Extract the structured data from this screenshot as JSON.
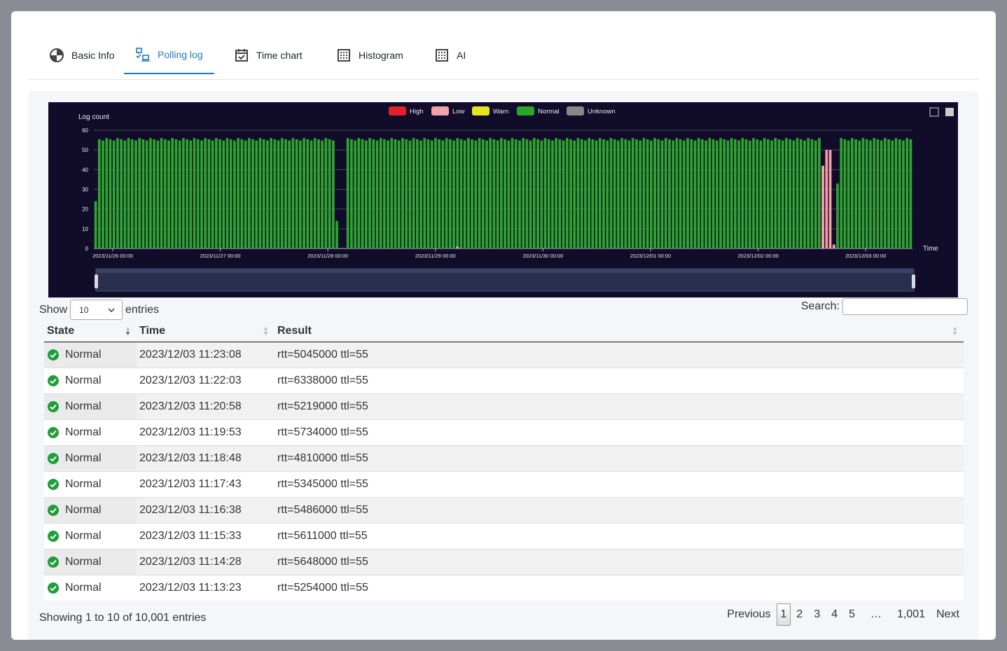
{
  "tabs": [
    {
      "label": "Basic Info",
      "icon": "pie-chart-icon",
      "active": false
    },
    {
      "label": "Polling log",
      "icon": "network-devices-icon",
      "active": true
    },
    {
      "label": "Time chart",
      "icon": "calendar-check-icon",
      "active": false
    },
    {
      "label": "Histogram",
      "icon": "grid-icon",
      "active": false
    },
    {
      "label": "AI",
      "icon": "grid-icon",
      "active": false
    }
  ],
  "chart_data": {
    "type": "bar",
    "ylabel": "Log count",
    "xlabel": "Time",
    "ylim": [
      0,
      60
    ],
    "yticks": [
      0,
      10,
      20,
      30,
      40,
      50,
      60
    ],
    "xticks": [
      "2023/11/26 00:00",
      "2023/11/27 00:00",
      "2023/11/28 00:00",
      "2023/11/29 00:00",
      "2023/11/30 00:00",
      "2023/12/01 00:00",
      "2023/12/02 00:00",
      "2023/12/03 00:00"
    ],
    "legend": [
      {
        "name": "High",
        "color": "#e0202a"
      },
      {
        "name": "Low",
        "color": "#f4a0a8"
      },
      {
        "name": "Warn",
        "color": "#e6e620"
      },
      {
        "name": "Normal",
        "color": "#2ea42e"
      },
      {
        "name": "Unknown",
        "color": "#888888"
      }
    ],
    "series_note_values": {
      "normal_typical": 56,
      "normal_dips": [
        {
          "index": 0,
          "value": 24
        },
        {
          "index": 66,
          "value": 14
        },
        {
          "index": 203,
          "value": 33
        }
      ],
      "low_spikes": [
        {
          "index": 199,
          "value": 42
        },
        {
          "index": 200,
          "value": 50
        },
        {
          "index": 201,
          "value": 50
        },
        {
          "index": 202,
          "value": 2
        },
        {
          "index": 99,
          "value": 1
        }
      ],
      "gaps": [
        67,
        68,
        200,
        201
      ]
    },
    "bar_count": 224,
    "grid": true,
    "legend_position": "top"
  },
  "table": {
    "show_label": "Show",
    "entries_label": "entries",
    "page_size": "10",
    "search_label": "Search:",
    "columns": [
      "State",
      "Time",
      "Result"
    ],
    "rows": [
      {
        "state": "Normal",
        "time": "2023/12/03 11:23:08",
        "result": "rtt=5045000 ttl=55"
      },
      {
        "state": "Normal",
        "time": "2023/12/03 11:22:03",
        "result": "rtt=6338000 ttl=55"
      },
      {
        "state": "Normal",
        "time": "2023/12/03 11:20:58",
        "result": "rtt=5219000 ttl=55"
      },
      {
        "state": "Normal",
        "time": "2023/12/03 11:19:53",
        "result": "rtt=5734000 ttl=55"
      },
      {
        "state": "Normal",
        "time": "2023/12/03 11:18:48",
        "result": "rtt=4810000 ttl=55"
      },
      {
        "state": "Normal",
        "time": "2023/12/03 11:17:43",
        "result": "rtt=5345000 ttl=55"
      },
      {
        "state": "Normal",
        "time": "2023/12/03 11:16:38",
        "result": "rtt=5486000 ttl=55"
      },
      {
        "state": "Normal",
        "time": "2023/12/03 11:15:33",
        "result": "rtt=5611000 ttl=55"
      },
      {
        "state": "Normal",
        "time": "2023/12/03 11:14:28",
        "result": "rtt=5648000 ttl=55"
      },
      {
        "state": "Normal",
        "time": "2023/12/03 11:13:23",
        "result": "rtt=5254000 ttl=55"
      }
    ],
    "info": "Showing 1 to 10 of 10,001 entries",
    "pager": {
      "prev": "Previous",
      "pages": [
        "1",
        "2",
        "3",
        "4",
        "5"
      ],
      "ellipsis": "…",
      "last": "1,001",
      "next": "Next",
      "current": "1"
    }
  }
}
